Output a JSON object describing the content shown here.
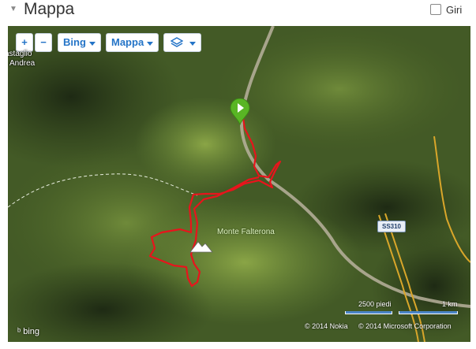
{
  "header": {
    "title": "Mappa",
    "laps_label": "Giri",
    "laps_checked": false
  },
  "controls": {
    "zoom_in": "+",
    "zoom_out": "−",
    "provider": "Bing",
    "map_type": "Mappa"
  },
  "map": {
    "places": {
      "town_line1": "astaglio",
      "town_line2": "Andrea"
    },
    "mountain": "Monte Falterona",
    "road": "SS310",
    "scale": {
      "feet": "2500 piedi",
      "km": "1 km"
    },
    "copyright_nokia": "© 2014 Nokia",
    "copyright_microsoft": "© 2014 Microsoft Corporation",
    "logo": "bing"
  },
  "colors": {
    "route": "#e8141c",
    "start_marker": "#59b524",
    "accent": "#2474c7"
  },
  "icons": {
    "collapse": "triangle-down-icon",
    "layers": "layers-icon",
    "start": "play-marker-icon",
    "summit": "mountain-icon"
  }
}
